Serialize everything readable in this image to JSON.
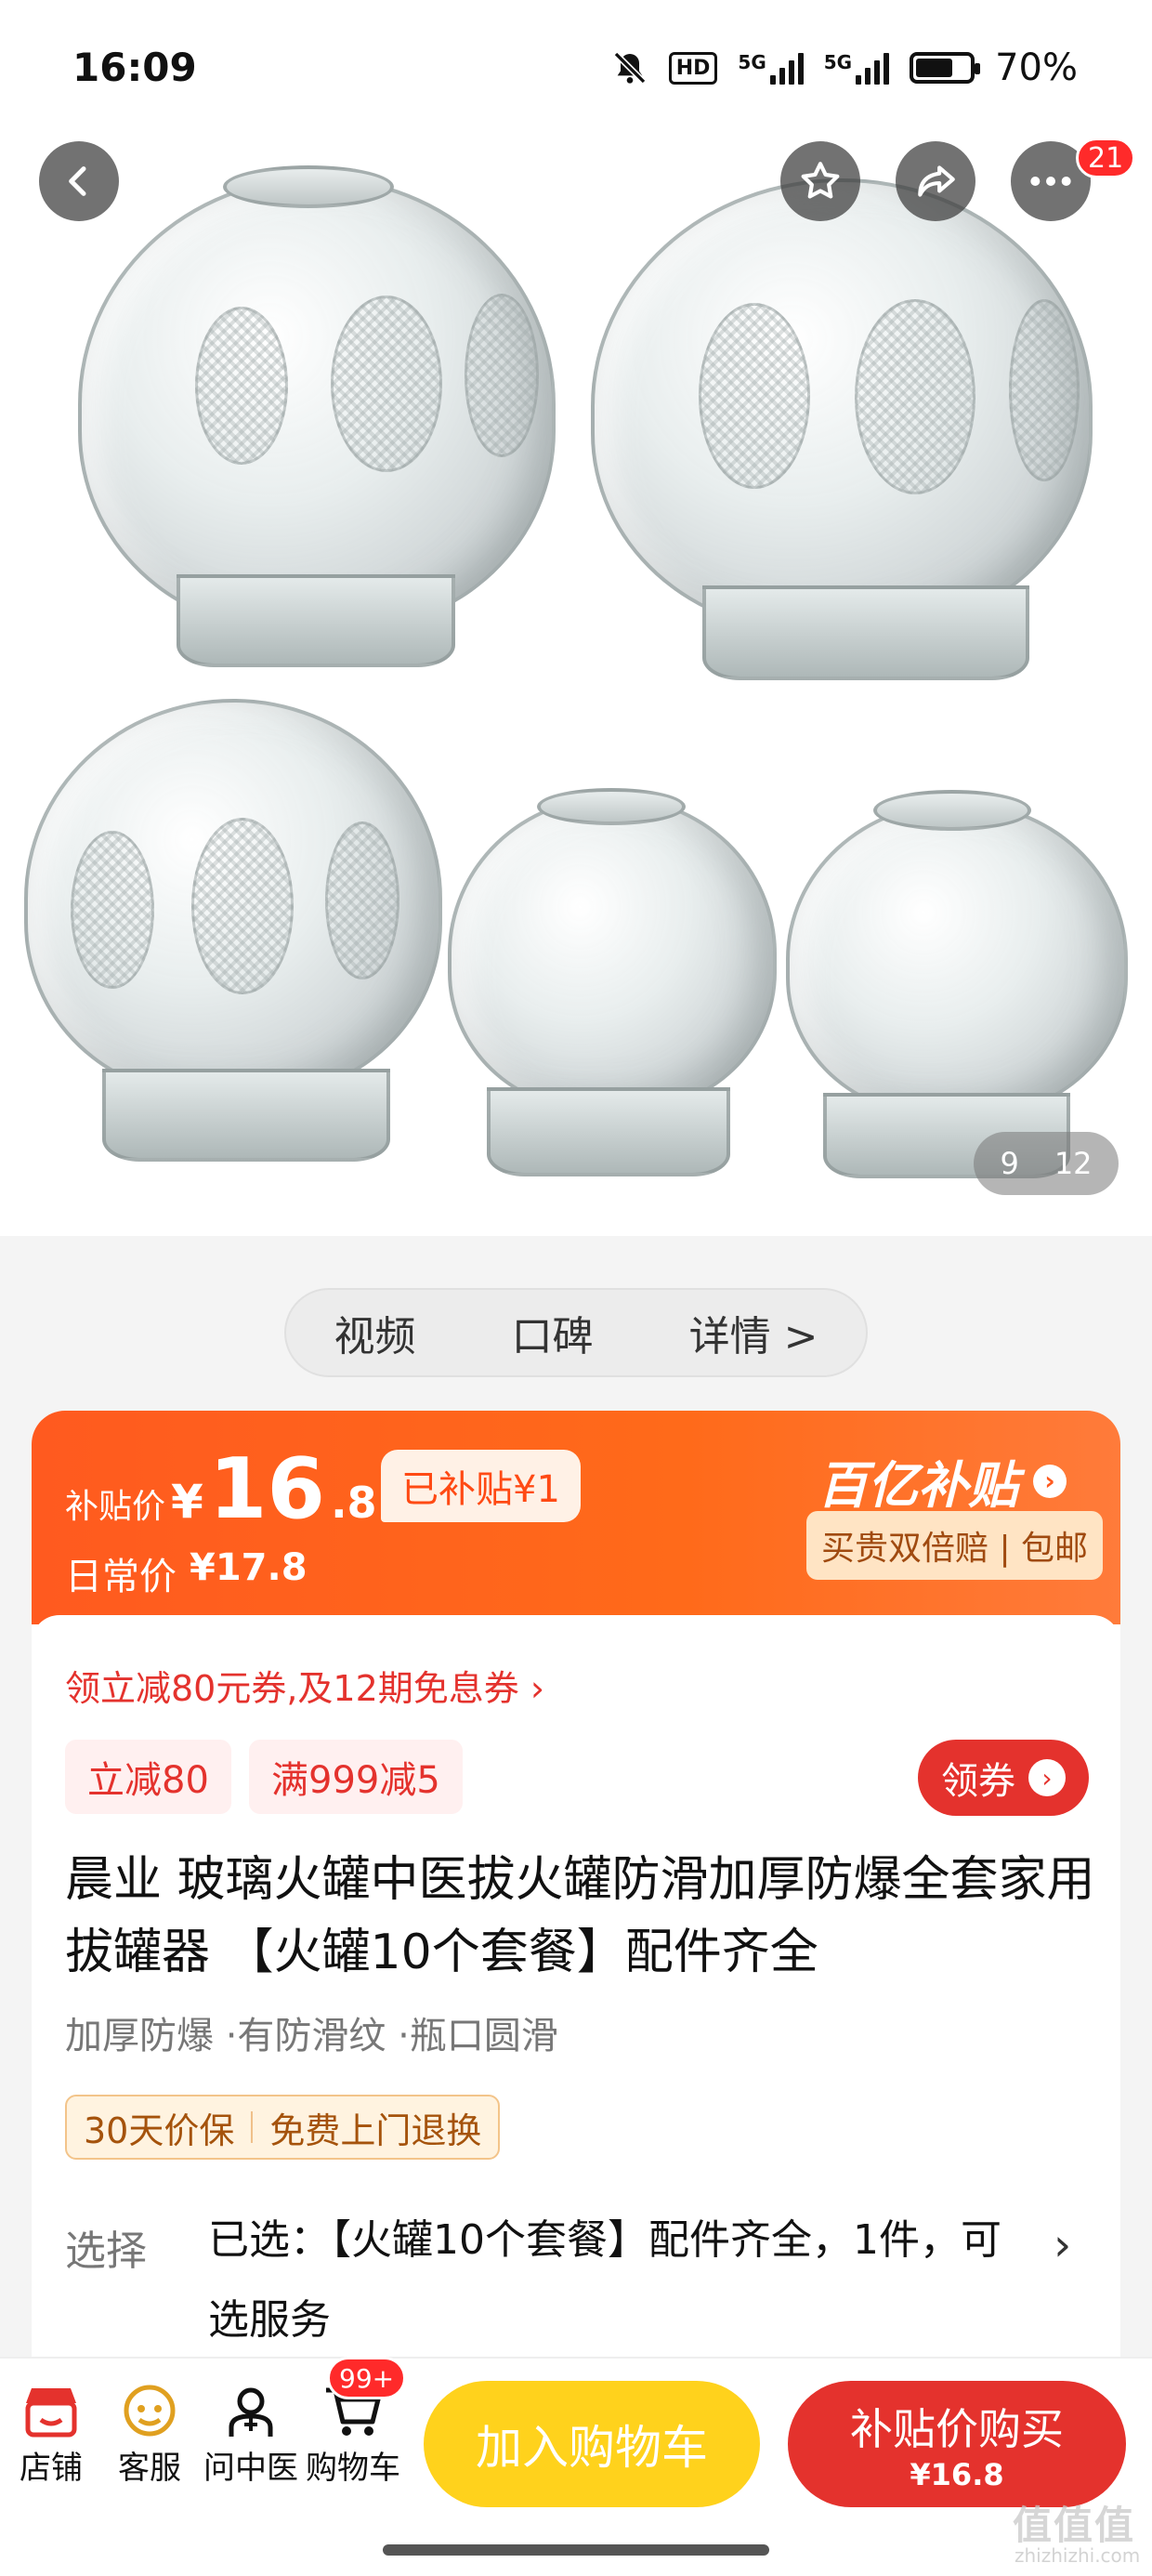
{
  "status": {
    "time": "16:09",
    "hd": "HD",
    "net1": "5G",
    "net2": "5G",
    "battery": "70%",
    "battery_level": 0.7
  },
  "gallery": {
    "index": "9",
    "total": "12",
    "more_badge": "21"
  },
  "nav_pills": {
    "video": "视频",
    "reviews": "口碑",
    "details": "详情 >"
  },
  "price_banner": {
    "subsidy_label": "补贴价",
    "currency": "¥",
    "price_int": "16",
    "price_dec": ".8",
    "subsidy_tag": "已补贴¥1",
    "regular_label": "日常价",
    "regular_price": "¥17.8",
    "program_name": "百亿补贴",
    "program_arrow": "›",
    "guarantee": "买贵双倍赔 | 包邮"
  },
  "coupons": {
    "headline": "领立减80元券,及12期免息券 ›",
    "chip1": "立减80",
    "chip2": "满999减5",
    "get_button": "领券",
    "get_arrow": "›"
  },
  "product": {
    "title": "晨业 玻璃火罐中医拔火罐防滑加厚防爆全套家用拔罐器 【火罐10个套餐】配件齐全",
    "tags": "加厚防爆 ·有防滑纹 ·瓶口圆滑",
    "promise1": "30天价保",
    "promise2": "免费上门退换",
    "select_label": "选择",
    "select_value": "已选：【火罐10个套餐】配件齐全，1件，可选服务",
    "select_chevron": "›"
  },
  "bottom_bar": {
    "shop": "店铺",
    "service": "客服",
    "doctor": "问中医",
    "cart": "购物车",
    "cart_badge": "99+",
    "add_to_cart": "加入购物车",
    "buy_now": "补贴价购买",
    "buy_price": "¥16.8"
  },
  "watermark": {
    "logo": "值值值",
    "domain": "zhizhizhi.com"
  },
  "colors": {
    "accent_red": "#e4322d",
    "banner_orange": "#ff5a1f",
    "cart_yellow": "#ffd21c"
  }
}
